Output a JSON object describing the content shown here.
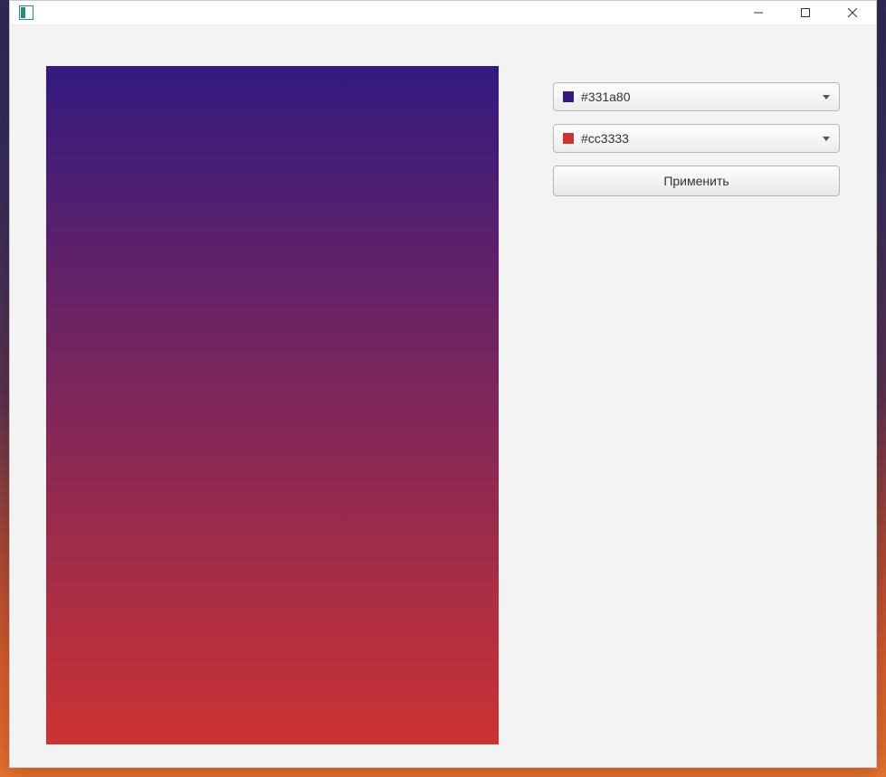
{
  "window": {
    "title": ""
  },
  "colors": {
    "top": {
      "hex": "#331a80",
      "label": "#331a80"
    },
    "bottom": {
      "hex": "#cc3333",
      "label": "#cc3333"
    }
  },
  "controls": {
    "apply_label": "Применить"
  }
}
